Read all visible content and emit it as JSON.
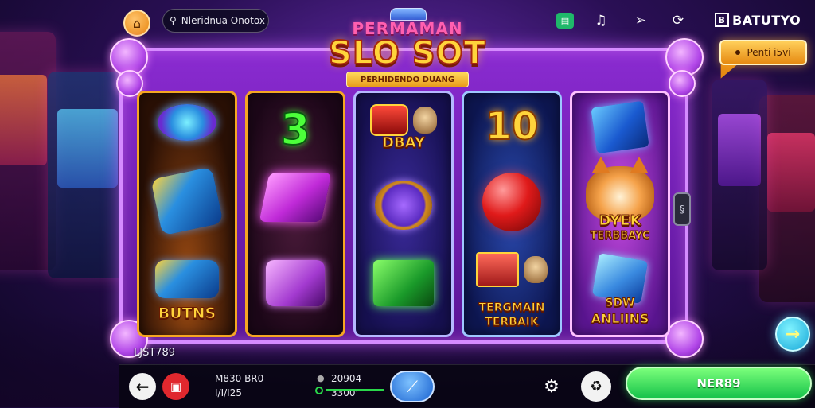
{
  "header": {
    "search_placeholder": "Nleridnua Onotox",
    "brand_label": "BATUTYO",
    "promo_label": "Penti i5vi"
  },
  "title": {
    "line1": "PERMAMAN",
    "line2": "SLO SOT",
    "ribbon": "PERHIDENDO DUANG"
  },
  "reels": {
    "reel1": {
      "bottom_label": "BUTNS"
    },
    "reel2": {
      "middle_symbol": "3"
    },
    "reel3": {
      "top_label": "DBAY"
    },
    "reel4": {
      "top_symbol": "10",
      "bottom_label_line1": "TERGMAIN",
      "bottom_label_line2": "TERBAIK"
    },
    "reel5": {
      "middle_label_line1": "DYEK",
      "middle_label_line2": "TERBBAYC",
      "bottom_label_line1": "SDW",
      "bottom_label_line2": "ANLIINS"
    }
  },
  "player": {
    "tag": "LJST789"
  },
  "bottombar": {
    "stat_a_line1": "M830 BR0",
    "stat_a_line2": "I/I/I25",
    "stat_b_value1": "20904",
    "stat_b_value2": "3300'",
    "cta_label": "NER89"
  },
  "colors": {
    "accent_gold": "#ffd43b",
    "frame_purple": "#8a2bd1",
    "cta_green": "#15c24a",
    "spin_blue": "#1a62d0"
  },
  "icons": {
    "home": "home-icon",
    "search": "search-icon",
    "chat": "chat-icon",
    "bell": "bell-icon",
    "plane": "paper-plane-icon",
    "loop": "loop-icon",
    "back": "back-arrow-icon",
    "app": "app-icon",
    "spin": "spin-icon",
    "settings": "gear-icon",
    "recycle": "recycle-icon",
    "next": "arrow-right-icon"
  }
}
